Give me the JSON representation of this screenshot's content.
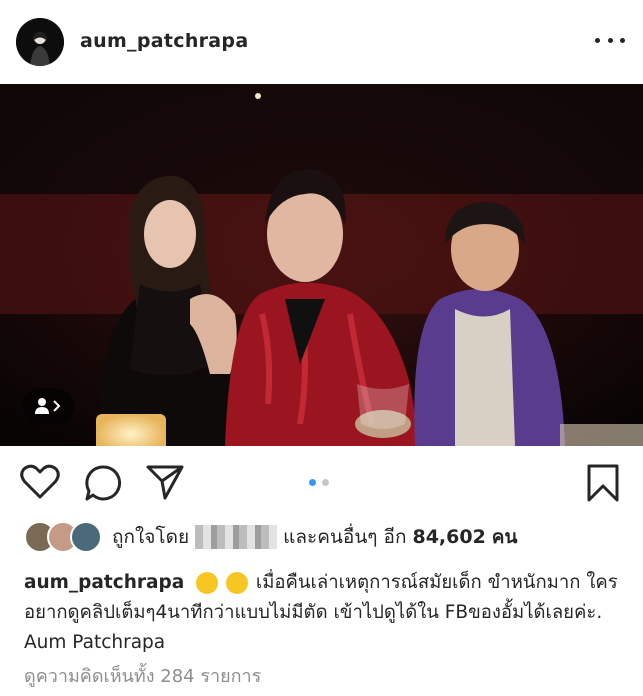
{
  "post": {
    "username": "aum_patchrapa",
    "more_icon": "more-horizontal-icon"
  },
  "media": {
    "carousel_index": 1,
    "carousel_total": 2,
    "tag_icon": "user-tag-icon"
  },
  "actions": {
    "like_icon": "heart-icon",
    "comment_icon": "comment-bubble-icon",
    "share_icon": "send-icon",
    "save_icon": "bookmark-icon"
  },
  "likes": {
    "prefix": "ถูกใจโดย",
    "middle": "และคนอื่นๆ อีก",
    "count": "84,602",
    "suffix": "คน",
    "liker_colors": [
      "#7a6a55",
      "#c59a86",
      "#4a6a7a"
    ]
  },
  "caption": {
    "username": "aum_patchrapa",
    "text": "เมื่อคืนเล่าเหตุการณ์สมัยเด็ก ขำหนักมาก ใครอยากดูคลิปเต็มๆ4นาทีกว่าแบบไม่มีตัด เข้าไปดูได้ใน FBของอั้มได้เลยค่ะ. Aum Patchrapa"
  },
  "comments": {
    "view_all": "ดูความคิดเห็นทั้ง 284 รายการ"
  },
  "colors": {
    "accent_blue": "#3897f0",
    "text": "#262626",
    "muted": "#8e8e8e"
  }
}
